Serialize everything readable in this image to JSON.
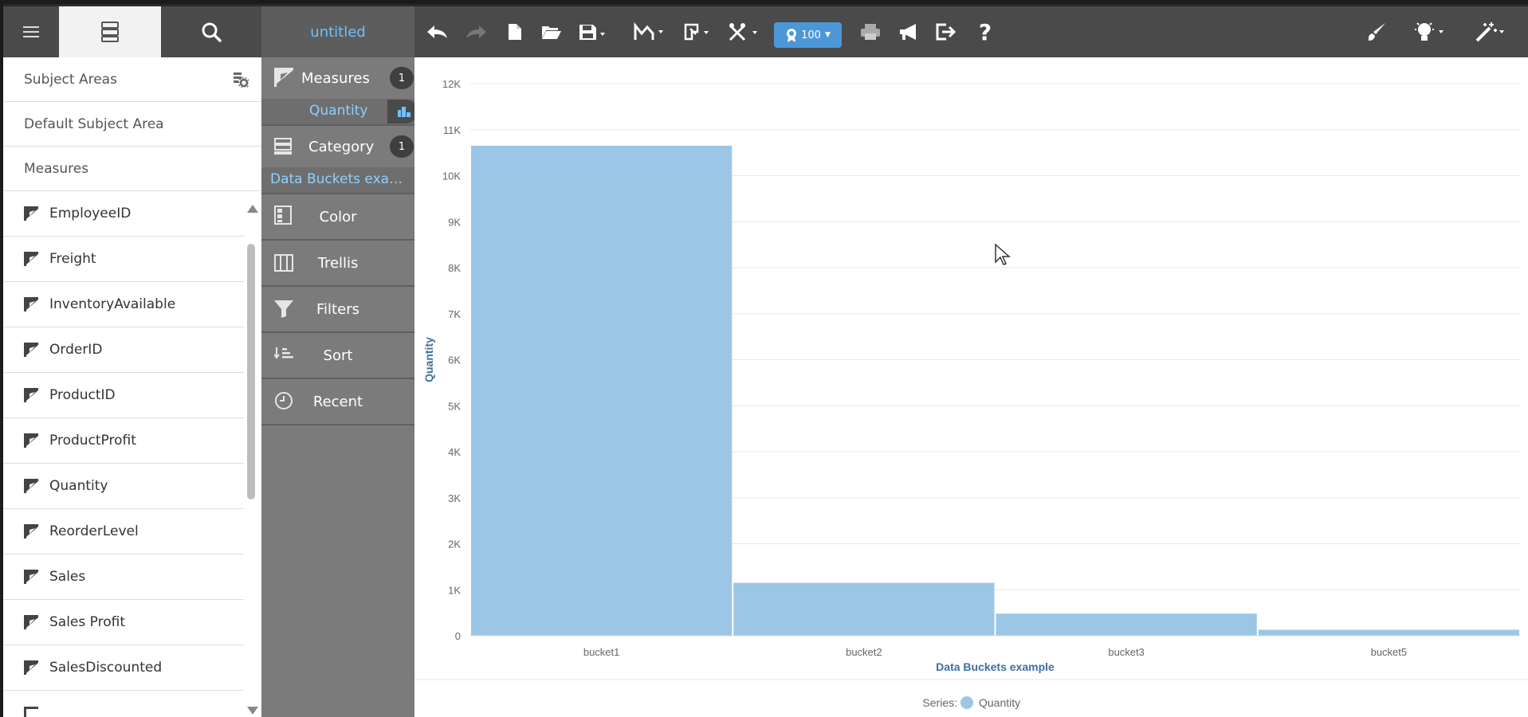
{
  "toolbar": {
    "title": "untitled",
    "zoom_badge": "100",
    "icons": [
      "menu-icon",
      "data-panel-icon",
      "search-icon",
      "undo-icon",
      "redo-icon",
      "new-file-icon",
      "open-folder-icon",
      "save-icon",
      "chart-type-icon",
      "format-icon",
      "tools-icon",
      "print-icon",
      "announce-icon",
      "export-icon",
      "help-icon",
      "brush-icon",
      "lightbulb-icon",
      "magic-wand-icon"
    ]
  },
  "left": {
    "header": "Subject Areas",
    "subject_area": "Default Subject Area",
    "section": "Measures",
    "items": [
      "EmployeeID",
      "Freight",
      "InventoryAvailable",
      "OrderID",
      "ProductID",
      "ProductProfit",
      "Quantity",
      "ReorderLevel",
      "Sales",
      "Sales Profit",
      "SalesDiscounted"
    ]
  },
  "middle": {
    "measures_label": "Measures",
    "measures_count": "1",
    "measure_field": "Quantity",
    "category_label": "Category",
    "category_count": "1",
    "category_field": "Data Buckets exa…",
    "color_label": "Color",
    "trellis_label": "Trellis",
    "filters_label": "Filters",
    "sort_label": "Sort",
    "recent_label": "Recent"
  },
  "chart_data": {
    "type": "bar",
    "categories": [
      "bucket1",
      "bucket2",
      "bucket3",
      "bucket5"
    ],
    "series": [
      {
        "name": "Quantity",
        "values": [
          10650,
          1150,
          480,
          130
        ]
      }
    ],
    "xlabel": "Data Buckets example",
    "ylabel": "Quantity",
    "ylim": [
      0,
      12000
    ],
    "yticks": [
      "0",
      "1K",
      "2K",
      "3K",
      "4K",
      "5K",
      "6K",
      "7K",
      "8K",
      "9K",
      "10K",
      "11K",
      "12K"
    ],
    "legend_prefix": "Series:",
    "legend_position": "bottom",
    "bar_color": "#9cc6e6",
    "grid": true
  }
}
